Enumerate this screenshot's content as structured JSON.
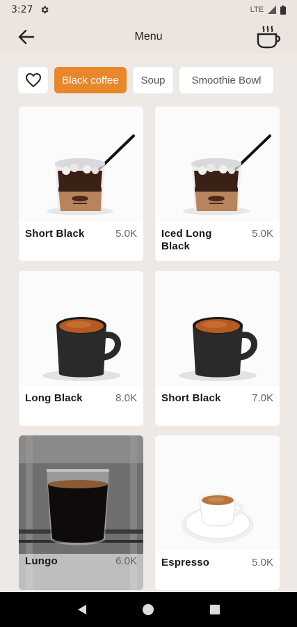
{
  "status_bar": {
    "time": "3:27",
    "network": "LTE",
    "icons": [
      "gear-icon",
      "signal-icon",
      "battery-icon"
    ]
  },
  "app_bar": {
    "title": "Menu",
    "back_icon": "arrow-left-icon",
    "cart_icon": "coffee-cup-icon"
  },
  "filters": {
    "favorite_icon": "heart-icon",
    "chips": [
      {
        "label": "Black coffee",
        "active": true
      },
      {
        "label": "Soup",
        "active": false
      },
      {
        "label": "Smoothie Bowl",
        "active": false
      }
    ]
  },
  "products": [
    {
      "name": "Short Black",
      "price": "5.0K",
      "image": "iced-coffee-cup"
    },
    {
      "name": "Iced Long Black",
      "price": "5.0K",
      "image": "iced-coffee-cup"
    },
    {
      "name": "Long Black",
      "price": "8.0K",
      "image": "black-mug"
    },
    {
      "name": "Short Black",
      "price": "7.0K",
      "image": "black-mug"
    },
    {
      "name": "Lungo",
      "price": "6.0K",
      "image": "glass-under-machine"
    },
    {
      "name": "Espresso",
      "price": "5.0K",
      "image": "espresso-cup"
    }
  ],
  "colors": {
    "background": "#efe9e6",
    "app_bar": "#ece4de",
    "accent": "#e8872c",
    "card": "#ffffff"
  },
  "nav_bar": {
    "icons": [
      "back-triangle-icon",
      "home-circle-icon",
      "recents-square-icon"
    ]
  }
}
